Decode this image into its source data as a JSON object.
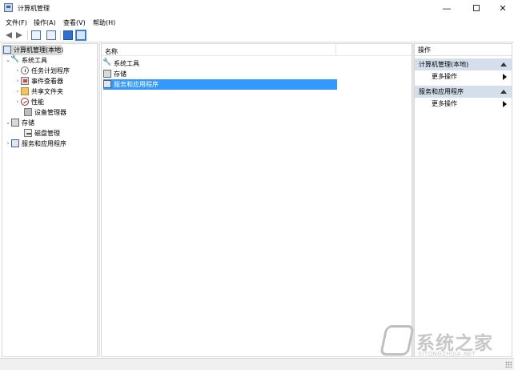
{
  "window": {
    "title": "计算机管理",
    "minimize": "—",
    "maximize": "",
    "close": "✕"
  },
  "menu": [
    "文件(F)",
    "操作(A)",
    "查看(V)",
    "帮助(H)"
  ],
  "tree": {
    "root": "计算机管理(本地)",
    "items": [
      {
        "label": "系统工具",
        "icon": "tools-icon"
      },
      {
        "label": "任务计划程序",
        "icon": "clock-icon"
      },
      {
        "label": "事件查看器",
        "icon": "viewer-icon"
      },
      {
        "label": "共享文件夹",
        "icon": "folder-icon"
      },
      {
        "label": "性能",
        "icon": "performance-icon"
      },
      {
        "label": "设备管理器",
        "icon": "device-icon"
      },
      {
        "label": "存储",
        "icon": "storage-icon"
      },
      {
        "label": "磁盘管理",
        "icon": "disk-icon"
      },
      {
        "label": "服务和应用程序",
        "icon": "services-icon"
      }
    ]
  },
  "center": {
    "column_name": "名称",
    "rows": [
      {
        "label": "系统工具",
        "icon": "tools-icon"
      },
      {
        "label": "存储",
        "icon": "storage-icon"
      },
      {
        "label": "服务和应用程序",
        "icon": "services-icon",
        "selected": true
      }
    ]
  },
  "actions": {
    "title": "操作",
    "sections": [
      {
        "header": "计算机管理(本地)",
        "item": "更多操作"
      },
      {
        "header": "服务和应用程序",
        "item": "更多操作"
      }
    ]
  },
  "watermark": {
    "text": "系统之家",
    "subtext": "XITONGZHIJIA.NET"
  },
  "colors": {
    "selection": "#3399ff",
    "section_header": "#d5dfeb",
    "pane_border": "#d6d6d6"
  }
}
